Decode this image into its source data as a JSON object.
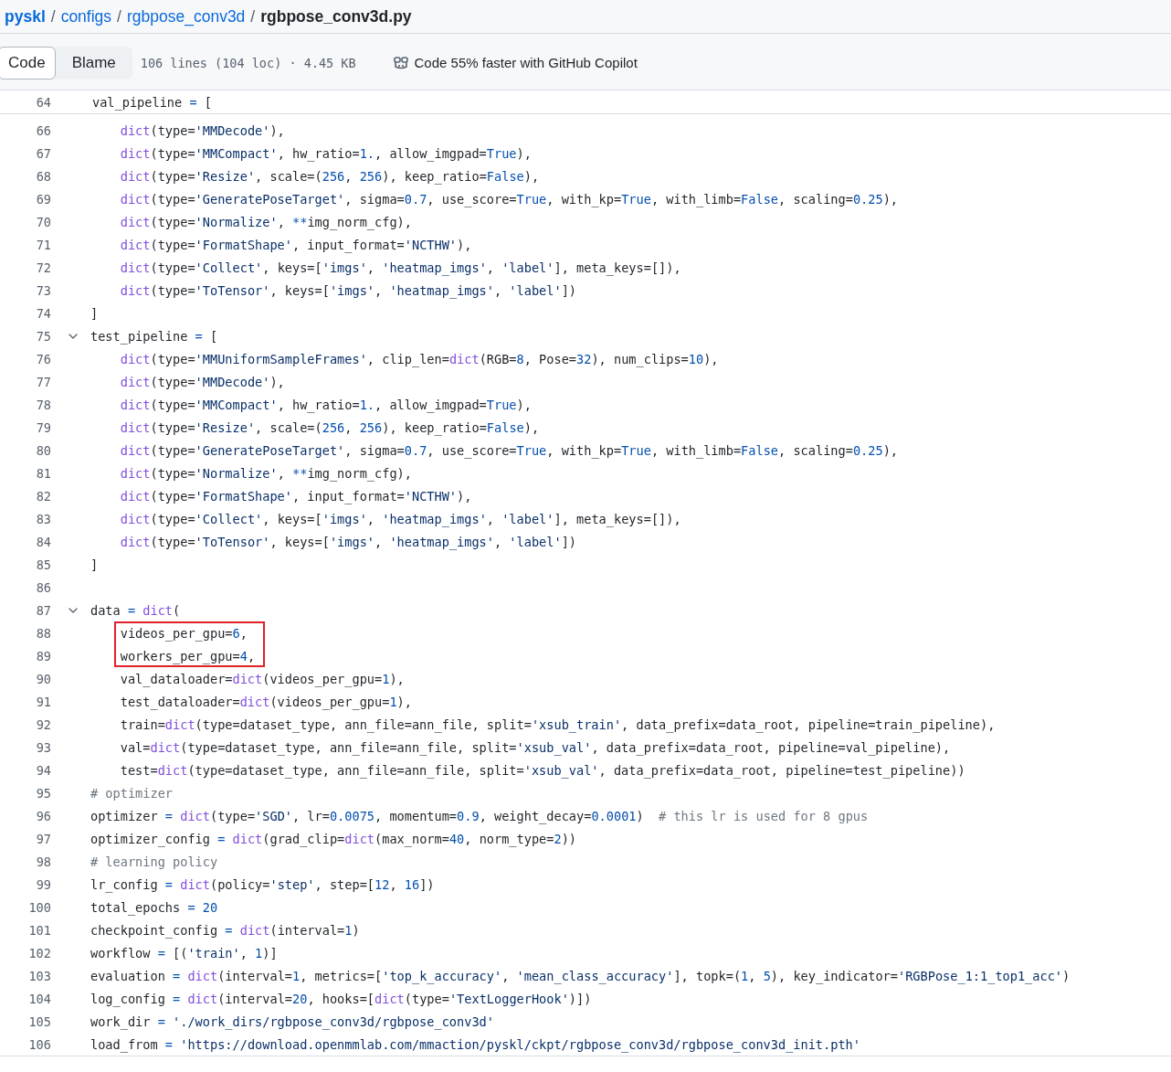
{
  "breadcrumb": {
    "links": [
      "pyskl",
      "configs",
      "rgbpose_conv3d"
    ],
    "separator": "/",
    "current": "rgbpose_conv3d.py"
  },
  "toolbar": {
    "tabs": [
      {
        "label": "Code",
        "selected": true
      },
      {
        "label": "Blame",
        "selected": false
      }
    ],
    "file_info": "106 lines (104 loc) · 4.45 KB",
    "copilot": "Code 55% faster with GitHub Copilot"
  },
  "sticky_line": {
    "number": "64",
    "tokens": [
      {
        "text": "val_pipeline ",
        "kind": "plain"
      },
      {
        "text": "= ",
        "kind": "op"
      },
      {
        "text": "[",
        "kind": "plain"
      }
    ]
  },
  "lines": [
    {
      "number": "66",
      "indented": true,
      "tokens": [
        {
          "text": "dict",
          "kind": "func"
        },
        {
          "text": "(type=",
          "kind": "plain"
        },
        {
          "text": "'MMDecode'",
          "kind": "str"
        },
        {
          "text": "),",
          "kind": "plain"
        }
      ]
    },
    {
      "number": "67",
      "indented": true,
      "tokens": [
        {
          "text": "dict",
          "kind": "func"
        },
        {
          "text": "(type=",
          "kind": "plain"
        },
        {
          "text": "'MMCompact'",
          "kind": "str"
        },
        {
          "text": ", hw_ratio=",
          "kind": "plain"
        },
        {
          "text": "1.",
          "kind": "num"
        },
        {
          "text": ", allow_imgpad=",
          "kind": "plain"
        },
        {
          "text": "True",
          "kind": "num"
        },
        {
          "text": "),",
          "kind": "plain"
        }
      ]
    },
    {
      "number": "68",
      "indented": true,
      "tokens": [
        {
          "text": "dict",
          "kind": "func"
        },
        {
          "text": "(type=",
          "kind": "plain"
        },
        {
          "text": "'Resize'",
          "kind": "str"
        },
        {
          "text": ", scale=(",
          "kind": "plain"
        },
        {
          "text": "256",
          "kind": "num"
        },
        {
          "text": ", ",
          "kind": "plain"
        },
        {
          "text": "256",
          "kind": "num"
        },
        {
          "text": "), keep_ratio=",
          "kind": "plain"
        },
        {
          "text": "False",
          "kind": "num"
        },
        {
          "text": "),",
          "kind": "plain"
        }
      ]
    },
    {
      "number": "69",
      "indented": true,
      "tokens": [
        {
          "text": "dict",
          "kind": "func"
        },
        {
          "text": "(type=",
          "kind": "plain"
        },
        {
          "text": "'GeneratePoseTarget'",
          "kind": "str"
        },
        {
          "text": ", sigma=",
          "kind": "plain"
        },
        {
          "text": "0.7",
          "kind": "num"
        },
        {
          "text": ", use_score=",
          "kind": "plain"
        },
        {
          "text": "True",
          "kind": "num"
        },
        {
          "text": ", with_kp=",
          "kind": "plain"
        },
        {
          "text": "True",
          "kind": "num"
        },
        {
          "text": ", with_limb=",
          "kind": "plain"
        },
        {
          "text": "False",
          "kind": "num"
        },
        {
          "text": ", scaling=",
          "kind": "plain"
        },
        {
          "text": "0.25",
          "kind": "num"
        },
        {
          "text": "),",
          "kind": "plain"
        }
      ]
    },
    {
      "number": "70",
      "indented": true,
      "tokens": [
        {
          "text": "dict",
          "kind": "func"
        },
        {
          "text": "(type=",
          "kind": "plain"
        },
        {
          "text": "'Normalize'",
          "kind": "str"
        },
        {
          "text": ", ",
          "kind": "plain"
        },
        {
          "text": "**",
          "kind": "op"
        },
        {
          "text": "img_norm_cfg),",
          "kind": "plain"
        }
      ]
    },
    {
      "number": "71",
      "indented": true,
      "tokens": [
        {
          "text": "dict",
          "kind": "func"
        },
        {
          "text": "(type=",
          "kind": "plain"
        },
        {
          "text": "'FormatShape'",
          "kind": "str"
        },
        {
          "text": ", input_format=",
          "kind": "plain"
        },
        {
          "text": "'NCTHW'",
          "kind": "str"
        },
        {
          "text": "),",
          "kind": "plain"
        }
      ]
    },
    {
      "number": "72",
      "indented": true,
      "tokens": [
        {
          "text": "dict",
          "kind": "func"
        },
        {
          "text": "(type=",
          "kind": "plain"
        },
        {
          "text": "'Collect'",
          "kind": "str"
        },
        {
          "text": ", keys=[",
          "kind": "plain"
        },
        {
          "text": "'imgs'",
          "kind": "str"
        },
        {
          "text": ", ",
          "kind": "plain"
        },
        {
          "text": "'heatmap_imgs'",
          "kind": "str"
        },
        {
          "text": ", ",
          "kind": "plain"
        },
        {
          "text": "'label'",
          "kind": "str"
        },
        {
          "text": "], meta_keys=[]),",
          "kind": "plain"
        }
      ]
    },
    {
      "number": "73",
      "indented": true,
      "tokens": [
        {
          "text": "dict",
          "kind": "func"
        },
        {
          "text": "(type=",
          "kind": "plain"
        },
        {
          "text": "'ToTensor'",
          "kind": "str"
        },
        {
          "text": ", keys=[",
          "kind": "plain"
        },
        {
          "text": "'imgs'",
          "kind": "str"
        },
        {
          "text": ", ",
          "kind": "plain"
        },
        {
          "text": "'heatmap_imgs'",
          "kind": "str"
        },
        {
          "text": ", ",
          "kind": "plain"
        },
        {
          "text": "'label'",
          "kind": "str"
        },
        {
          "text": "])",
          "kind": "plain"
        }
      ]
    },
    {
      "number": "74",
      "tokens": [
        {
          "text": "]",
          "kind": "plain"
        }
      ]
    },
    {
      "number": "75",
      "expanded": true,
      "tokens": [
        {
          "text": "test_pipeline ",
          "kind": "plain"
        },
        {
          "text": "= ",
          "kind": "op"
        },
        {
          "text": "[",
          "kind": "plain"
        }
      ]
    },
    {
      "number": "76",
      "indented": true,
      "tokens": [
        {
          "text": "dict",
          "kind": "func"
        },
        {
          "text": "(type=",
          "kind": "plain"
        },
        {
          "text": "'MMUniformSampleFrames'",
          "kind": "str"
        },
        {
          "text": ", clip_len=",
          "kind": "plain"
        },
        {
          "text": "dict",
          "kind": "func"
        },
        {
          "text": "(RGB=",
          "kind": "plain"
        },
        {
          "text": "8",
          "kind": "num"
        },
        {
          "text": ", Pose=",
          "kind": "plain"
        },
        {
          "text": "32",
          "kind": "num"
        },
        {
          "text": "), num_clips=",
          "kind": "plain"
        },
        {
          "text": "10",
          "kind": "num"
        },
        {
          "text": "),",
          "kind": "plain"
        }
      ]
    },
    {
      "number": "77",
      "indented": true,
      "tokens": [
        {
          "text": "dict",
          "kind": "func"
        },
        {
          "text": "(type=",
          "kind": "plain"
        },
        {
          "text": "'MMDecode'",
          "kind": "str"
        },
        {
          "text": "),",
          "kind": "plain"
        }
      ]
    },
    {
      "number": "78",
      "indented": true,
      "tokens": [
        {
          "text": "dict",
          "kind": "func"
        },
        {
          "text": "(type=",
          "kind": "plain"
        },
        {
          "text": "'MMCompact'",
          "kind": "str"
        },
        {
          "text": ", hw_ratio=",
          "kind": "plain"
        },
        {
          "text": "1.",
          "kind": "num"
        },
        {
          "text": ", allow_imgpad=",
          "kind": "plain"
        },
        {
          "text": "True",
          "kind": "num"
        },
        {
          "text": "),",
          "kind": "plain"
        }
      ]
    },
    {
      "number": "79",
      "indented": true,
      "tokens": [
        {
          "text": "dict",
          "kind": "func"
        },
        {
          "text": "(type=",
          "kind": "plain"
        },
        {
          "text": "'Resize'",
          "kind": "str"
        },
        {
          "text": ", scale=(",
          "kind": "plain"
        },
        {
          "text": "256",
          "kind": "num"
        },
        {
          "text": ", ",
          "kind": "plain"
        },
        {
          "text": "256",
          "kind": "num"
        },
        {
          "text": "), keep_ratio=",
          "kind": "plain"
        },
        {
          "text": "False",
          "kind": "num"
        },
        {
          "text": "),",
          "kind": "plain"
        }
      ]
    },
    {
      "number": "80",
      "indented": true,
      "tokens": [
        {
          "text": "dict",
          "kind": "func"
        },
        {
          "text": "(type=",
          "kind": "plain"
        },
        {
          "text": "'GeneratePoseTarget'",
          "kind": "str"
        },
        {
          "text": ", sigma=",
          "kind": "plain"
        },
        {
          "text": "0.7",
          "kind": "num"
        },
        {
          "text": ", use_score=",
          "kind": "plain"
        },
        {
          "text": "True",
          "kind": "num"
        },
        {
          "text": ", with_kp=",
          "kind": "plain"
        },
        {
          "text": "True",
          "kind": "num"
        },
        {
          "text": ", with_limb=",
          "kind": "plain"
        },
        {
          "text": "False",
          "kind": "num"
        },
        {
          "text": ", scaling=",
          "kind": "plain"
        },
        {
          "text": "0.25",
          "kind": "num"
        },
        {
          "text": "),",
          "kind": "plain"
        }
      ]
    },
    {
      "number": "81",
      "indented": true,
      "tokens": [
        {
          "text": "dict",
          "kind": "func"
        },
        {
          "text": "(type=",
          "kind": "plain"
        },
        {
          "text": "'Normalize'",
          "kind": "str"
        },
        {
          "text": ", ",
          "kind": "plain"
        },
        {
          "text": "**",
          "kind": "op"
        },
        {
          "text": "img_norm_cfg),",
          "kind": "plain"
        }
      ]
    },
    {
      "number": "82",
      "indented": true,
      "tokens": [
        {
          "text": "dict",
          "kind": "func"
        },
        {
          "text": "(type=",
          "kind": "plain"
        },
        {
          "text": "'FormatShape'",
          "kind": "str"
        },
        {
          "text": ", input_format=",
          "kind": "plain"
        },
        {
          "text": "'NCTHW'",
          "kind": "str"
        },
        {
          "text": "),",
          "kind": "plain"
        }
      ]
    },
    {
      "number": "83",
      "indented": true,
      "tokens": [
        {
          "text": "dict",
          "kind": "func"
        },
        {
          "text": "(type=",
          "kind": "plain"
        },
        {
          "text": "'Collect'",
          "kind": "str"
        },
        {
          "text": ", keys=[",
          "kind": "plain"
        },
        {
          "text": "'imgs'",
          "kind": "str"
        },
        {
          "text": ", ",
          "kind": "plain"
        },
        {
          "text": "'heatmap_imgs'",
          "kind": "str"
        },
        {
          "text": ", ",
          "kind": "plain"
        },
        {
          "text": "'label'",
          "kind": "str"
        },
        {
          "text": "], meta_keys=[]),",
          "kind": "plain"
        }
      ]
    },
    {
      "number": "84",
      "indented": true,
      "tokens": [
        {
          "text": "dict",
          "kind": "func"
        },
        {
          "text": "(type=",
          "kind": "plain"
        },
        {
          "text": "'ToTensor'",
          "kind": "str"
        },
        {
          "text": ", keys=[",
          "kind": "plain"
        },
        {
          "text": "'imgs'",
          "kind": "str"
        },
        {
          "text": ", ",
          "kind": "plain"
        },
        {
          "text": "'heatmap_imgs'",
          "kind": "str"
        },
        {
          "text": ", ",
          "kind": "plain"
        },
        {
          "text": "'label'",
          "kind": "str"
        },
        {
          "text": "])",
          "kind": "plain"
        }
      ]
    },
    {
      "number": "85",
      "tokens": [
        {
          "text": "]",
          "kind": "plain"
        }
      ]
    },
    {
      "number": "86"
    },
    {
      "number": "87",
      "expanded": true,
      "tokens": [
        {
          "text": "data ",
          "kind": "plain"
        },
        {
          "text": "= ",
          "kind": "op"
        },
        {
          "text": "dict",
          "kind": "func"
        },
        {
          "text": "(",
          "kind": "plain"
        }
      ]
    },
    {
      "number": "88",
      "indented": true,
      "boxed": true,
      "tokens": [
        {
          "text": "videos_per_gpu=",
          "kind": "plain"
        },
        {
          "text": "6",
          "kind": "num"
        },
        {
          "text": ",",
          "kind": "plain"
        }
      ]
    },
    {
      "number": "89",
      "indented": true,
      "boxed": true,
      "tokens": [
        {
          "text": "workers_per_gpu=",
          "kind": "plain"
        },
        {
          "text": "4",
          "kind": "num"
        },
        {
          "text": ",",
          "kind": "plain"
        }
      ]
    },
    {
      "number": "90",
      "indented": true,
      "tokens": [
        {
          "text": "val_dataloader=",
          "kind": "plain"
        },
        {
          "text": "dict",
          "kind": "func"
        },
        {
          "text": "(videos_per_gpu=",
          "kind": "plain"
        },
        {
          "text": "1",
          "kind": "num"
        },
        {
          "text": "),",
          "kind": "plain"
        }
      ]
    },
    {
      "number": "91",
      "indented": true,
      "tokens": [
        {
          "text": "test_dataloader=",
          "kind": "plain"
        },
        {
          "text": "dict",
          "kind": "func"
        },
        {
          "text": "(videos_per_gpu=",
          "kind": "plain"
        },
        {
          "text": "1",
          "kind": "num"
        },
        {
          "text": "),",
          "kind": "plain"
        }
      ]
    },
    {
      "number": "92",
      "indented": true,
      "tokens": [
        {
          "text": "train=",
          "kind": "plain"
        },
        {
          "text": "dict",
          "kind": "func"
        },
        {
          "text": "(type=dataset_type, ann_file=ann_file, split=",
          "kind": "plain"
        },
        {
          "text": "'xsub_train'",
          "kind": "str"
        },
        {
          "text": ", data_prefix=data_root, pipeline=train_pipeline),",
          "kind": "plain"
        }
      ]
    },
    {
      "number": "93",
      "indented": true,
      "tokens": [
        {
          "text": "val=",
          "kind": "plain"
        },
        {
          "text": "dict",
          "kind": "func"
        },
        {
          "text": "(type=dataset_type, ann_file=ann_file, split=",
          "kind": "plain"
        },
        {
          "text": "'xsub_val'",
          "kind": "str"
        },
        {
          "text": ", data_prefix=data_root, pipeline=val_pipeline),",
          "kind": "plain"
        }
      ]
    },
    {
      "number": "94",
      "indented": true,
      "tokens": [
        {
          "text": "test=",
          "kind": "plain"
        },
        {
          "text": "dict",
          "kind": "func"
        },
        {
          "text": "(type=dataset_type, ann_file=ann_file, split=",
          "kind": "plain"
        },
        {
          "text": "'xsub_val'",
          "kind": "str"
        },
        {
          "text": ", data_prefix=data_root, pipeline=test_pipeline))",
          "kind": "plain"
        }
      ]
    },
    {
      "number": "95",
      "tokens": [
        {
          "text": "# optimizer",
          "kind": "comment"
        }
      ]
    },
    {
      "number": "96",
      "tokens": [
        {
          "text": "optimizer ",
          "kind": "plain"
        },
        {
          "text": "= ",
          "kind": "op"
        },
        {
          "text": "dict",
          "kind": "func"
        },
        {
          "text": "(type=",
          "kind": "plain"
        },
        {
          "text": "'SGD'",
          "kind": "str"
        },
        {
          "text": ", lr=",
          "kind": "plain"
        },
        {
          "text": "0.0075",
          "kind": "num"
        },
        {
          "text": ", momentum=",
          "kind": "plain"
        },
        {
          "text": "0.9",
          "kind": "num"
        },
        {
          "text": ", weight_decay=",
          "kind": "plain"
        },
        {
          "text": "0.0001",
          "kind": "num"
        },
        {
          "text": ")  ",
          "kind": "plain"
        },
        {
          "text": "# this lr is used for 8 gpus",
          "kind": "comment"
        }
      ]
    },
    {
      "number": "97",
      "tokens": [
        {
          "text": "optimizer_config ",
          "kind": "plain"
        },
        {
          "text": "= ",
          "kind": "op"
        },
        {
          "text": "dict",
          "kind": "func"
        },
        {
          "text": "(grad_clip=",
          "kind": "plain"
        },
        {
          "text": "dict",
          "kind": "func"
        },
        {
          "text": "(max_norm=",
          "kind": "plain"
        },
        {
          "text": "40",
          "kind": "num"
        },
        {
          "text": ", norm_type=",
          "kind": "plain"
        },
        {
          "text": "2",
          "kind": "num"
        },
        {
          "text": "))",
          "kind": "plain"
        }
      ]
    },
    {
      "number": "98",
      "tokens": [
        {
          "text": "# learning policy",
          "kind": "comment"
        }
      ]
    },
    {
      "number": "99",
      "tokens": [
        {
          "text": "lr_config ",
          "kind": "plain"
        },
        {
          "text": "= ",
          "kind": "op"
        },
        {
          "text": "dict",
          "kind": "func"
        },
        {
          "text": "(policy=",
          "kind": "plain"
        },
        {
          "text": "'step'",
          "kind": "str"
        },
        {
          "text": ", step=[",
          "kind": "plain"
        },
        {
          "text": "12",
          "kind": "num"
        },
        {
          "text": ", ",
          "kind": "plain"
        },
        {
          "text": "16",
          "kind": "num"
        },
        {
          "text": "])",
          "kind": "plain"
        }
      ]
    },
    {
      "number": "100",
      "tokens": [
        {
          "text": "total_epochs ",
          "kind": "plain"
        },
        {
          "text": "= ",
          "kind": "op"
        },
        {
          "text": "20",
          "kind": "num"
        }
      ]
    },
    {
      "number": "101",
      "tokens": [
        {
          "text": "checkpoint_config ",
          "kind": "plain"
        },
        {
          "text": "= ",
          "kind": "op"
        },
        {
          "text": "dict",
          "kind": "func"
        },
        {
          "text": "(interval=",
          "kind": "plain"
        },
        {
          "text": "1",
          "kind": "num"
        },
        {
          "text": ")",
          "kind": "plain"
        }
      ]
    },
    {
      "number": "102",
      "tokens": [
        {
          "text": "workflow ",
          "kind": "plain"
        },
        {
          "text": "= ",
          "kind": "op"
        },
        {
          "text": "[(",
          "kind": "plain"
        },
        {
          "text": "'train'",
          "kind": "str"
        },
        {
          "text": ", ",
          "kind": "plain"
        },
        {
          "text": "1",
          "kind": "num"
        },
        {
          "text": ")]",
          "kind": "plain"
        }
      ]
    },
    {
      "number": "103",
      "tokens": [
        {
          "text": "evaluation ",
          "kind": "plain"
        },
        {
          "text": "= ",
          "kind": "op"
        },
        {
          "text": "dict",
          "kind": "func"
        },
        {
          "text": "(interval=",
          "kind": "plain"
        },
        {
          "text": "1",
          "kind": "num"
        },
        {
          "text": ", metrics=[",
          "kind": "plain"
        },
        {
          "text": "'top_k_accuracy'",
          "kind": "str"
        },
        {
          "text": ", ",
          "kind": "plain"
        },
        {
          "text": "'mean_class_accuracy'",
          "kind": "str"
        },
        {
          "text": "], topk=(",
          "kind": "plain"
        },
        {
          "text": "1",
          "kind": "num"
        },
        {
          "text": ", ",
          "kind": "plain"
        },
        {
          "text": "5",
          "kind": "num"
        },
        {
          "text": "), key_indicator=",
          "kind": "plain"
        },
        {
          "text": "'RGBPose_1:1_top1_acc'",
          "kind": "str"
        },
        {
          "text": ")",
          "kind": "plain"
        }
      ]
    },
    {
      "number": "104",
      "tokens": [
        {
          "text": "log_config ",
          "kind": "plain"
        },
        {
          "text": "= ",
          "kind": "op"
        },
        {
          "text": "dict",
          "kind": "func"
        },
        {
          "text": "(interval=",
          "kind": "plain"
        },
        {
          "text": "20",
          "kind": "num"
        },
        {
          "text": ", hooks=[",
          "kind": "plain"
        },
        {
          "text": "dict",
          "kind": "func"
        },
        {
          "text": "(type=",
          "kind": "plain"
        },
        {
          "text": "'TextLoggerHook'",
          "kind": "str"
        },
        {
          "text": ")])",
          "kind": "plain"
        }
      ]
    },
    {
      "number": "105",
      "tokens": [
        {
          "text": "work_dir ",
          "kind": "plain"
        },
        {
          "text": "= ",
          "kind": "op"
        },
        {
          "text": "'./work_dirs/rgbpose_conv3d/rgbpose_conv3d'",
          "kind": "str"
        }
      ]
    },
    {
      "number": "106",
      "tokens": [
        {
          "text": "load_from ",
          "kind": "plain"
        },
        {
          "text": "= ",
          "kind": "op"
        },
        {
          "text": "'https://download.openmmlab.com/mmaction/pyskl/ckpt/rgbpose_conv3d/rgbpose_conv3d_init.pth'",
          "kind": "str"
        }
      ]
    }
  ]
}
